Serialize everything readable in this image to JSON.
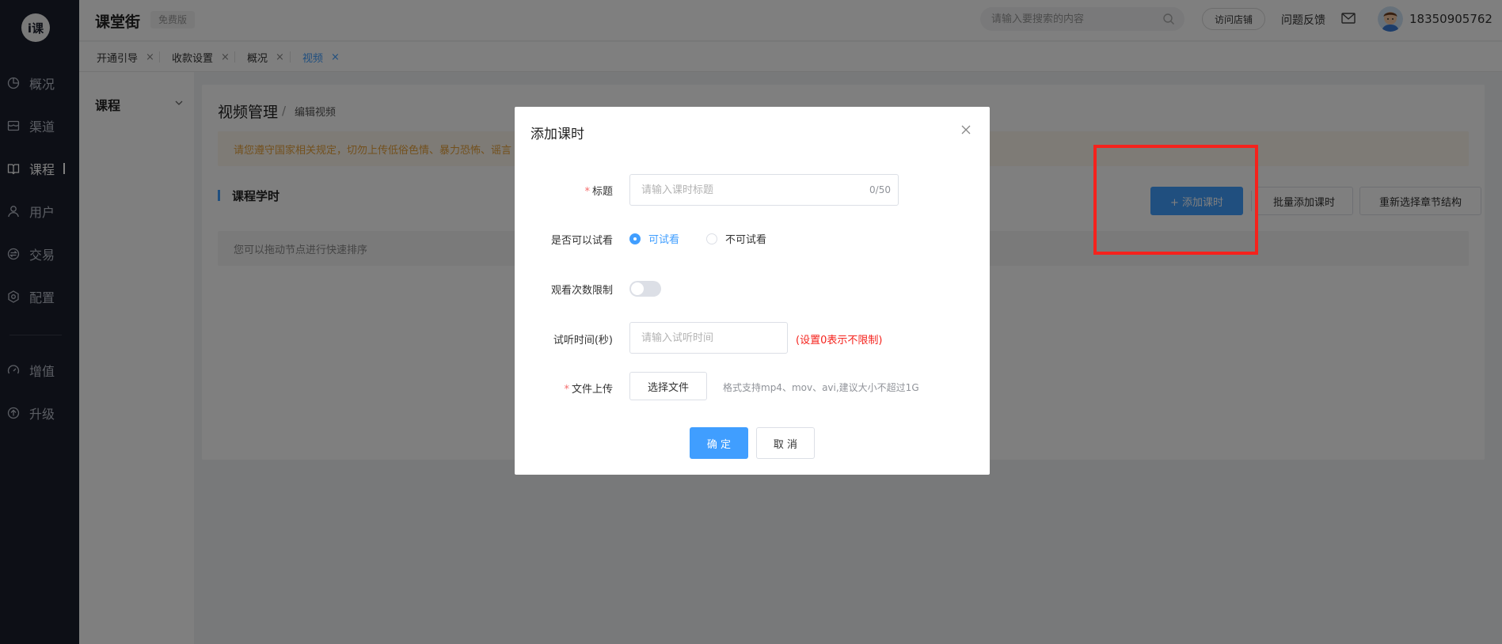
{
  "app": {
    "logo_text": "i课",
    "title": "课堂街",
    "edition": "免费版"
  },
  "header": {
    "search_placeholder": "请输入要搜索的内容",
    "visit_store": "访问店铺",
    "feedback": "问题反馈",
    "username": "18350905762"
  },
  "sidebar": {
    "items": [
      {
        "label": "概况",
        "icon": "pie-chart-icon"
      },
      {
        "label": "渠道",
        "icon": "storefront-icon"
      },
      {
        "label": "课程",
        "icon": "book-icon",
        "active": true
      },
      {
        "label": "用户",
        "icon": "user-icon"
      },
      {
        "label": "交易",
        "icon": "exchange-icon"
      },
      {
        "label": "配置",
        "icon": "gear-icon"
      }
    ],
    "extra_items": [
      {
        "label": "增值",
        "icon": "gauge-icon"
      },
      {
        "label": "升级",
        "icon": "upgrade-icon"
      }
    ]
  },
  "tabs": [
    {
      "label": "开通引导",
      "close": "×"
    },
    {
      "label": "收款设置",
      "close": "×"
    },
    {
      "label": "概况",
      "close": "×"
    },
    {
      "label": "视频",
      "close": "×",
      "active": true
    }
  ],
  "subnav": {
    "title": "课程"
  },
  "main": {
    "breadcrumb": {
      "main": "视频管理",
      "sep": "/",
      "sub": "编辑视频"
    },
    "notice": "请您遵守国家相关规定，切勿上传低俗色情、暴力恐怖、谣言",
    "section_title": "课程学时",
    "add_button": "+ 添加课时",
    "batch_button": "批量添加课时",
    "reselect_button": "重新选择章节结构",
    "drag_tip": "您可以拖动节点进行快速排序"
  },
  "modal": {
    "title": "添加课时",
    "fields": {
      "title_label": "标题",
      "title_placeholder": "请输入课时标题",
      "title_counter": "0/50",
      "trial_label": "是否可以试看",
      "trial_yes": "可试看",
      "trial_no": "不可试看",
      "trial_selected": "可试看",
      "limit_label": "观看次数限制",
      "limit_enabled": false,
      "time_label": "试听时间(秒)",
      "time_placeholder": "请输入试听时间",
      "time_hint": "(设置0表示不限制)",
      "upload_label": "文件上传",
      "upload_button": "选择文件",
      "upload_hint": "格式支持mp4、mov、avi,建议大小不超过1G",
      "required_mark": "*"
    },
    "ok": "确 定",
    "cancel": "取 消"
  },
  "colors": {
    "primary": "#409eff",
    "sidebar_bg": "#1b1f2c",
    "highlight": "#f5221c",
    "warning_text": "#e6a23c"
  }
}
